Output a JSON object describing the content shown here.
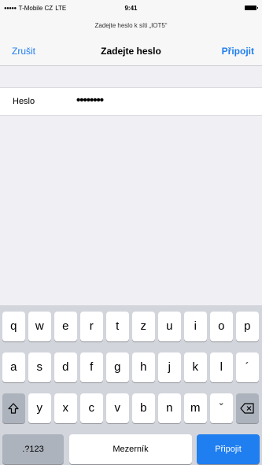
{
  "status_bar": {
    "carrier": "T-Mobile CZ",
    "network": "LTE",
    "time": "9:41"
  },
  "nav": {
    "prompt": "Zadejte heslo k síti „IOT5“",
    "cancel_label": "Zrušit",
    "title": "Zadejte heslo",
    "join_label": "Připojit"
  },
  "form": {
    "password_label": "Heslo",
    "password_value": "••••••••"
  },
  "keyboard": {
    "row1": [
      "q",
      "w",
      "e",
      "r",
      "t",
      "z",
      "u",
      "i",
      "o",
      "p"
    ],
    "row2": [
      "a",
      "s",
      "d",
      "f",
      "g",
      "h",
      "j",
      "k",
      "l",
      "´"
    ],
    "row3": [
      "y",
      "x",
      "c",
      "v",
      "b",
      "n",
      "m",
      "ˇ"
    ],
    "numbers_label": ".?123",
    "space_label": "Mezerník",
    "join_label": "Připojit",
    "shift_icon": "shift-arrow",
    "delete_icon": "backspace"
  }
}
